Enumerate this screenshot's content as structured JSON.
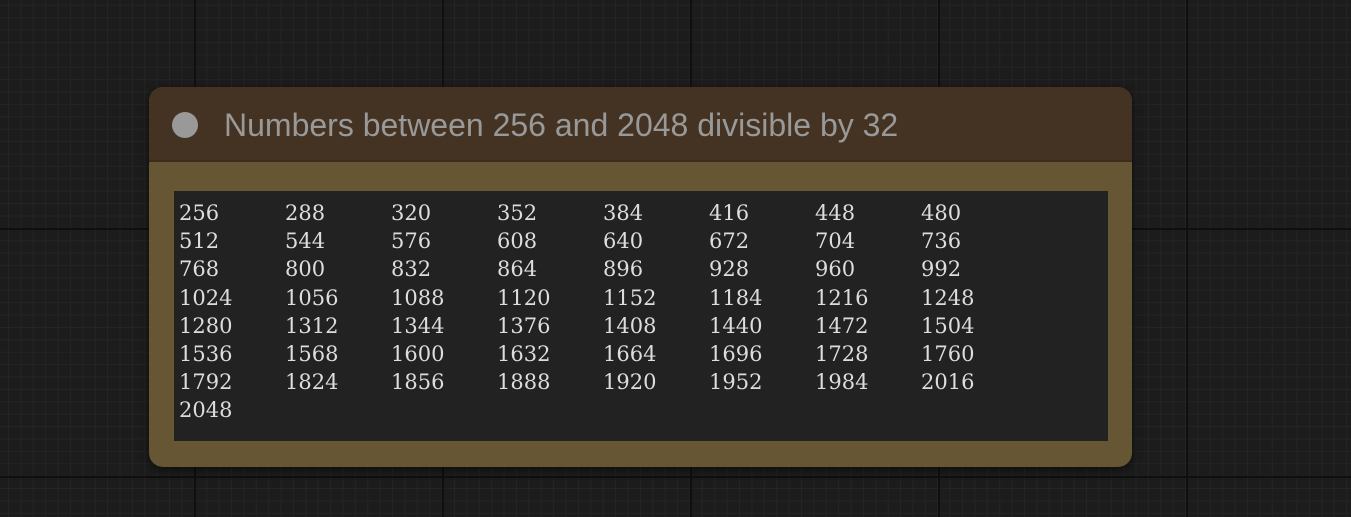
{
  "node": {
    "title": "Numbers between 256 and 2048 divisible by 32",
    "status_dot_color": "#999999",
    "header_color": "#443322",
    "body_color": "#665633",
    "output": {
      "rows": [
        [
          "256",
          "288",
          "320",
          "352",
          "384",
          "416",
          "448",
          "480"
        ],
        [
          "512",
          "544",
          "576",
          "608",
          "640",
          "672",
          "704",
          "736"
        ],
        [
          "768",
          "800",
          "832",
          "864",
          "896",
          "928",
          "960",
          "992"
        ],
        [
          "1024",
          "1056",
          "1088",
          "1120",
          "1152",
          "1184",
          "1216",
          "1248"
        ],
        [
          "1280",
          "1312",
          "1344",
          "1376",
          "1408",
          "1440",
          "1472",
          "1504"
        ],
        [
          "1536",
          "1568",
          "1600",
          "1632",
          "1664",
          "1696",
          "1728",
          "1760"
        ],
        [
          "1792",
          "1824",
          "1856",
          "1888",
          "1920",
          "1952",
          "1984",
          "2016"
        ],
        [
          "2048"
        ]
      ]
    }
  }
}
